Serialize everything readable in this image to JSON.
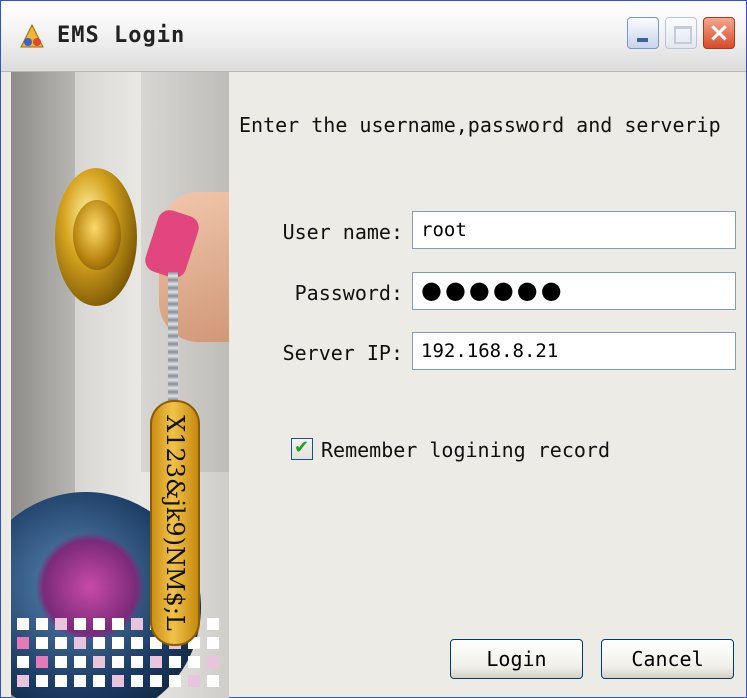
{
  "window": {
    "title": "EMS Login",
    "icons": {
      "app": "ems-app-icon",
      "minimize": "minimize-icon",
      "maximize": "maximize-icon",
      "close": "close-icon"
    }
  },
  "side_image": {
    "tag_text": "X123&jk9)NM$;L"
  },
  "form": {
    "instruction": "Enter the username,password and serverip",
    "username_label": "User name:",
    "username_value": "root",
    "password_label": "Password:",
    "password_value": "●●●●●●",
    "server_label": "Server IP:",
    "server_value": "192.168.8.21",
    "remember_label": "Remember logining record",
    "remember_checked": true
  },
  "buttons": {
    "login": "Login",
    "cancel": "Cancel"
  },
  "colors": {
    "check": "#21a121",
    "close_button": "#d9492a"
  }
}
